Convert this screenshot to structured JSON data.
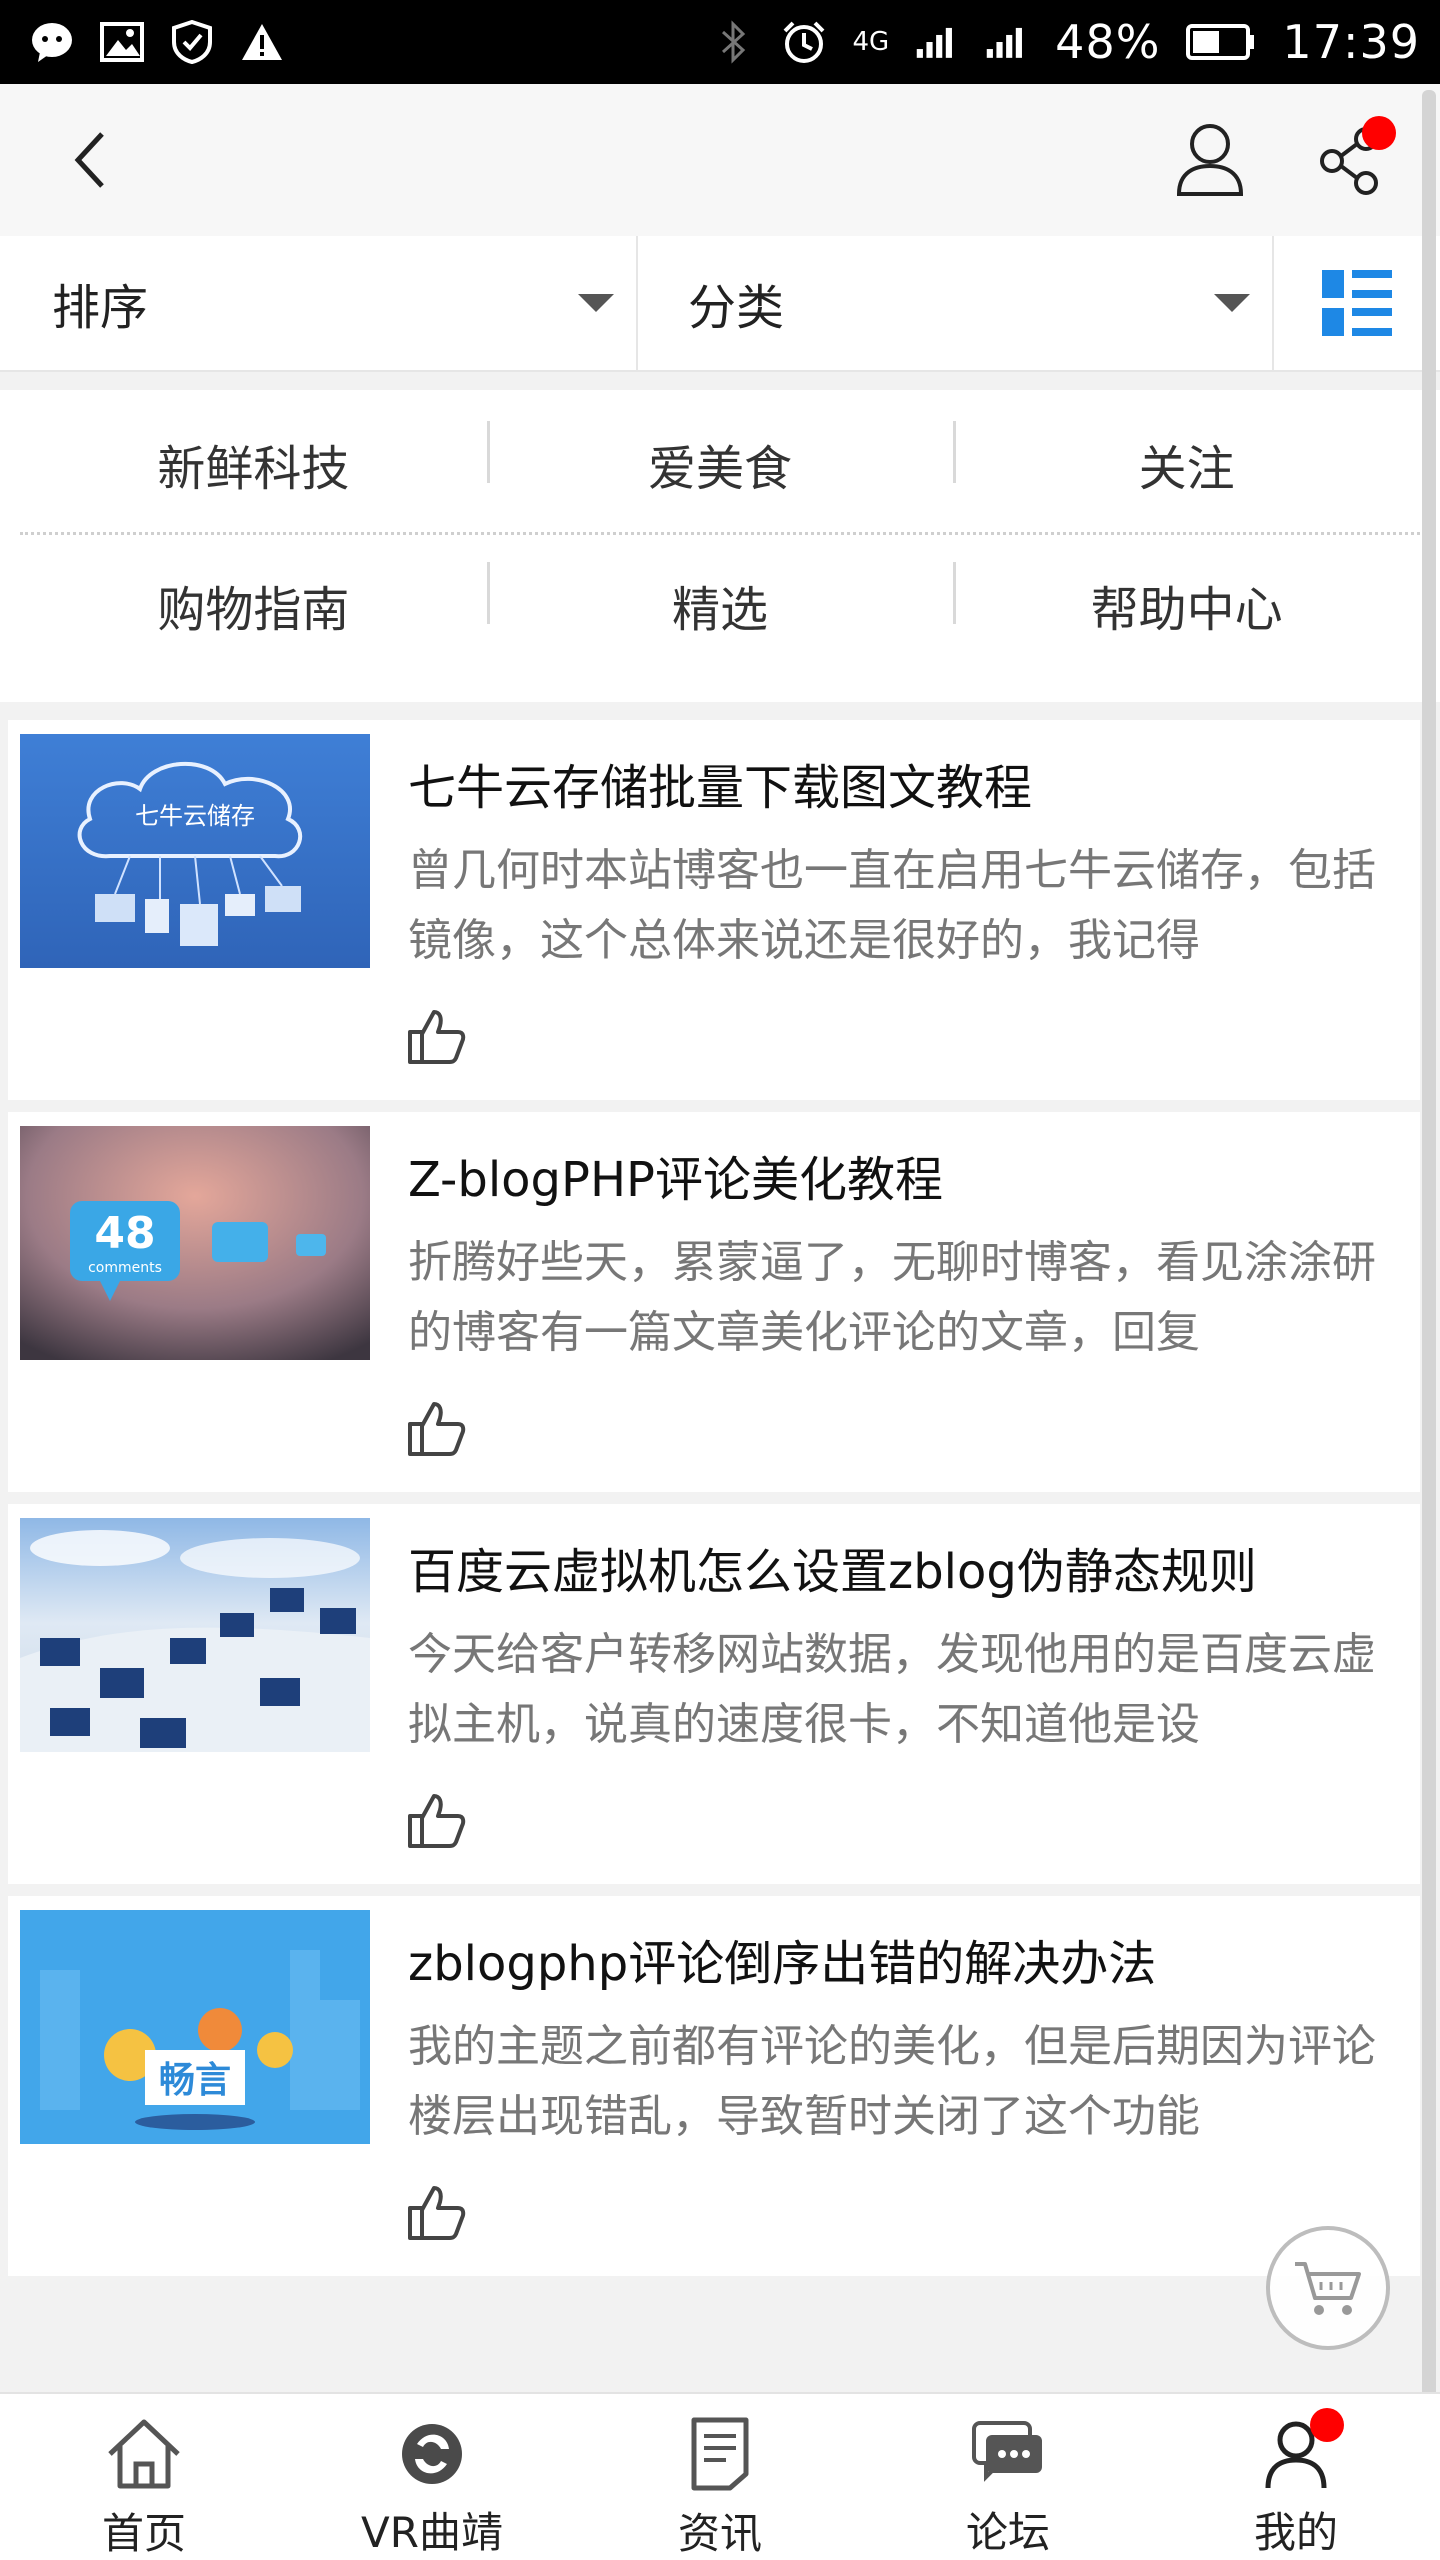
{
  "status_bar": {
    "network": "4G",
    "battery": "48%",
    "time": "17:39"
  },
  "header": {
    "back_icon": "chevron-left-icon",
    "user_icon": "user-icon",
    "share_icon": "share-icon",
    "badge_color": "#ff0000"
  },
  "filters": {
    "sort_label": "排序",
    "category_label": "分类",
    "accent": "#1e88e5"
  },
  "categories": [
    [
      "新鲜科技",
      "爱美食",
      "关注"
    ],
    [
      "购物指南",
      "精选",
      "帮助中心"
    ]
  ],
  "articles": [
    {
      "title": "七牛云存储批量下载图文教程",
      "summary": "曾几何时本站博客也一直在启用七牛云储存，包括镜像，这个总体来说还是很好的，我记得",
      "thumb_text": "七牛云储存"
    },
    {
      "title": "Z-blogPHP评论美化教程",
      "summary": "折腾好些天，累蒙逼了，无聊时博客，看见涂涂研的博客有一篇文章美化评论的文章，回复",
      "thumb_text": "48",
      "thumb_sub": "comments"
    },
    {
      "title": "百度云虚拟机怎么设置zblog伪静态规则",
      "summary": "今天给客户转移网站数据，发现他用的是百度云虚拟主机，说真的速度很卡，不知道他是设"
    },
    {
      "title": "zblogphp评论倒序出错的解决办法",
      "summary": "我的主题之前都有评论的美化，但是后期因为评论楼层出现错乱，导致暂时关闭了这个功能",
      "thumb_text": "畅言"
    }
  ],
  "bottom_nav": [
    {
      "label": "首页",
      "icon": "home-icon"
    },
    {
      "label": "VR曲靖",
      "icon": "vr-icon"
    },
    {
      "label": "资讯",
      "icon": "news-icon"
    },
    {
      "label": "论坛",
      "icon": "forum-icon"
    },
    {
      "label": "我的",
      "icon": "user-icon"
    }
  ]
}
